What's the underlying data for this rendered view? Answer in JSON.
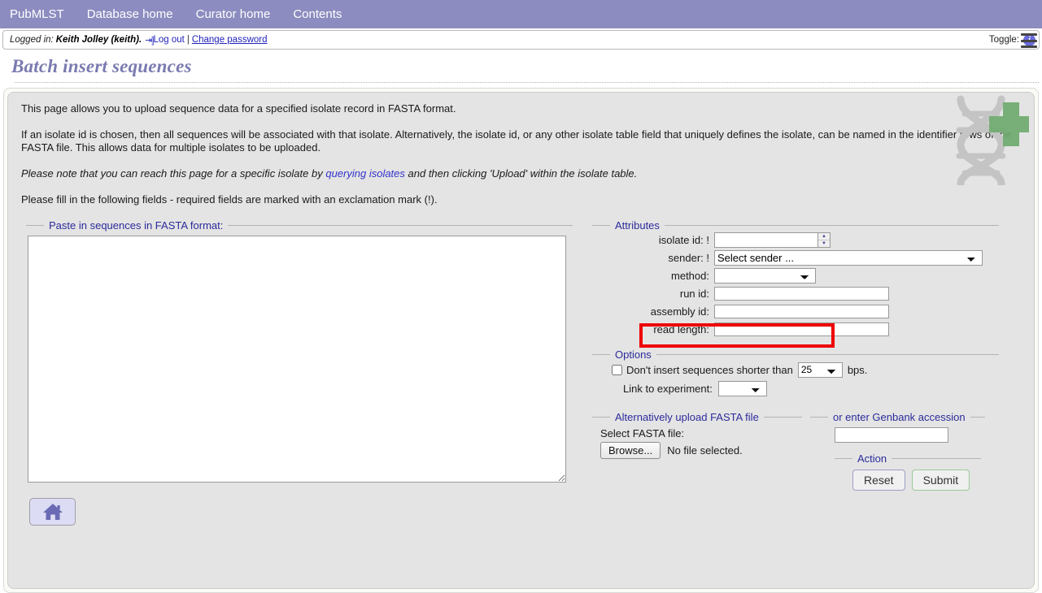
{
  "nav": {
    "items": [
      {
        "label": "PubMLST",
        "name": "nav-pubmlst"
      },
      {
        "label": "Database home",
        "name": "nav-database-home"
      },
      {
        "label": "Curator home",
        "name": "nav-curator-home"
      },
      {
        "label": "Contents",
        "name": "nav-contents"
      }
    ]
  },
  "login": {
    "prefix": "Logged in:",
    "user": "Keith Jolley (keith).",
    "logout": "Log out",
    "separator": "|",
    "change_password": "Change password",
    "toggle_label": "Toggle:",
    "info_glyph": "i"
  },
  "page": {
    "title": "Batch insert sequences",
    "paragraphs": {
      "p1": "This page allows you to upload sequence data for a specified isolate record in FASTA format.",
      "p2": "If an isolate id is chosen, then all sequences will be associated with that isolate. Alternatively, the isolate id, or any other isolate table field that uniquely defines the isolate, can be named in the identifier rows of the FASTA file. This allows data for multiple isolates to be uploaded.",
      "p3_before": "Please note that you can reach this page for a specific isolate by ",
      "p3_link": "querying isolates",
      "p3_after": " and then clicking 'Upload' within the isolate table.",
      "p4": "Please fill in the following fields - required fields are marked with an exclamation mark (!)."
    }
  },
  "fasta_panel": {
    "legend": "Paste in sequences in FASTA format:",
    "textarea_value": "",
    "textarea_placeholder": ""
  },
  "attributes": {
    "legend": "Attributes",
    "fields": [
      {
        "label": "isolate id: !",
        "name": "isolate-id",
        "value": "",
        "type": "spinner"
      },
      {
        "label": "sender: !",
        "name": "sender",
        "value": "Select sender ...",
        "type": "select"
      },
      {
        "label": "method:",
        "name": "method",
        "value": "",
        "type": "select"
      },
      {
        "label": "run id:",
        "name": "run-id",
        "value": "",
        "type": "text"
      },
      {
        "label": "assembly id:",
        "name": "assembly-id",
        "value": "",
        "type": "text"
      },
      {
        "label": "read length:",
        "name": "read-length",
        "value": "",
        "type": "text"
      }
    ],
    "highlight_color": "#ee0000",
    "highlighted_field": "read length:"
  },
  "options": {
    "legend": "Options",
    "min_length_checkbox_checked": false,
    "min_length_text": "Don't insert sequences shorter than",
    "min_length_value": "25",
    "min_length_units": "bps.",
    "link_experiment_label": "Link to experiment:",
    "link_experiment_value": ""
  },
  "upload": {
    "legend": "Alternatively upload FASTA file",
    "select_file_label": "Select FASTA file:",
    "browse_button": "Browse...",
    "no_file_text": "No file selected."
  },
  "genbank": {
    "legend": "or enter Genbank accession",
    "value": ""
  },
  "action": {
    "legend": "Action",
    "reset_label": "Reset",
    "submit_label": "Submit"
  },
  "home": {
    "icon": "home-icon"
  },
  "colors": {
    "nav_bar": "#8c8cc0",
    "title": "#7a7ab0",
    "legend": "#2b2b9c",
    "link": "#3333cc",
    "highlight": "#ee0000",
    "watermark_dna": "#c4c4c4",
    "watermark_plus": "#6faa6f"
  }
}
